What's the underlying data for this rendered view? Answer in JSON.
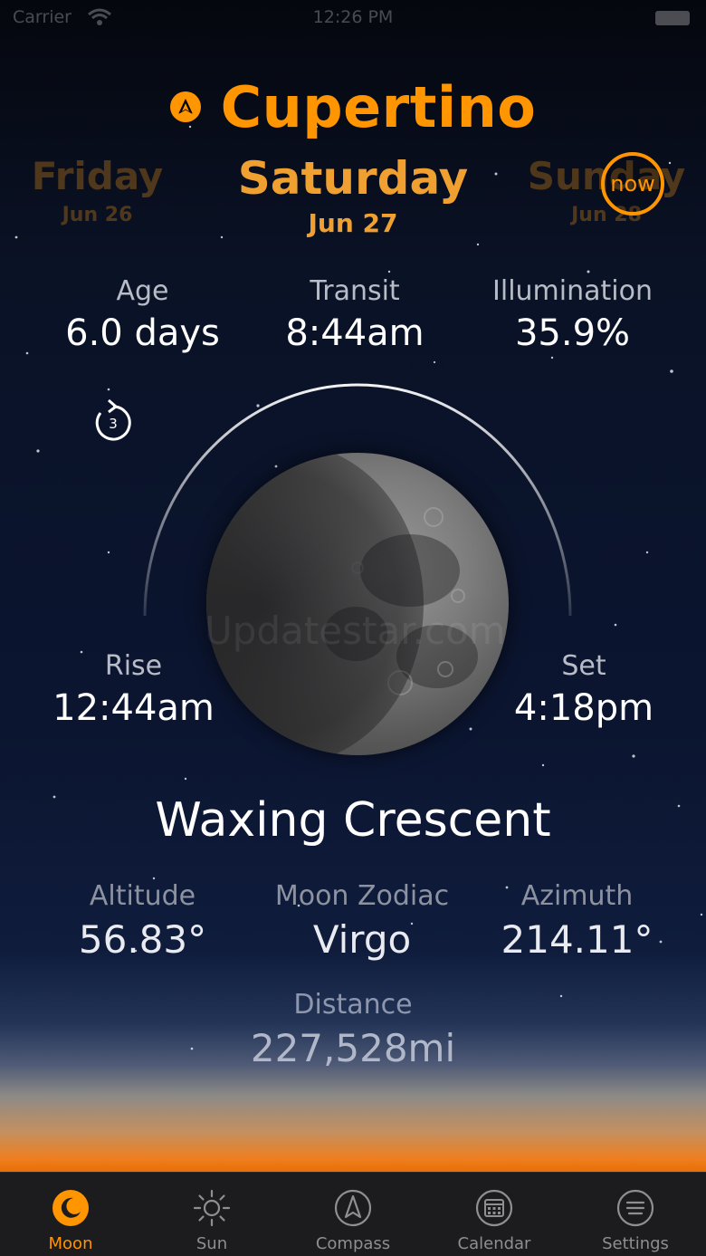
{
  "status_bar": {
    "carrier": "Carrier",
    "time": "12:26 PM"
  },
  "location": {
    "city": "Cupertino",
    "icon": "location-arrow-icon"
  },
  "days": {
    "previous": {
      "name": "Friday",
      "date": "Jun 26"
    },
    "current": {
      "name": "Saturday",
      "date": "Jun 27"
    },
    "next": {
      "name": "Sunday",
      "date": "Jun 28"
    }
  },
  "now_button": "now",
  "top_stats": {
    "age": {
      "label": "Age",
      "value": "6.0 days"
    },
    "transit": {
      "label": "Transit",
      "value": "8:44am"
    },
    "illumination": {
      "label": "Illumination",
      "value": "35.9%"
    }
  },
  "replay": {
    "count": "3",
    "icon": "replay-icon"
  },
  "rise": {
    "label": "Rise",
    "value": "12:44am"
  },
  "set": {
    "label": "Set",
    "value": "4:18pm"
  },
  "watermark": "Updatestar.com",
  "phase_name": "Waxing Crescent",
  "bottom_stats": {
    "altitude": {
      "label": "Altitude",
      "value": "56.83°"
    },
    "zodiac": {
      "label": "Moon Zodiac",
      "value": "Virgo"
    },
    "azimuth": {
      "label": "Azimuth",
      "value": "214.11°"
    },
    "distance": {
      "label": "Distance",
      "value": "227,528mi"
    }
  },
  "tabs": [
    {
      "label": "Moon",
      "icon": "moon-icon",
      "active": true
    },
    {
      "label": "Sun",
      "icon": "sun-icon",
      "active": false
    },
    {
      "label": "Compass",
      "icon": "compass-icon",
      "active": false
    },
    {
      "label": "Calendar",
      "icon": "calendar-icon",
      "active": false
    },
    {
      "label": "Settings",
      "icon": "settings-icon",
      "active": false
    }
  ],
  "colors": {
    "accent": "#ff9500",
    "tab_bar": "#1c1c1e",
    "inactive_tab": "#8e8e93"
  }
}
